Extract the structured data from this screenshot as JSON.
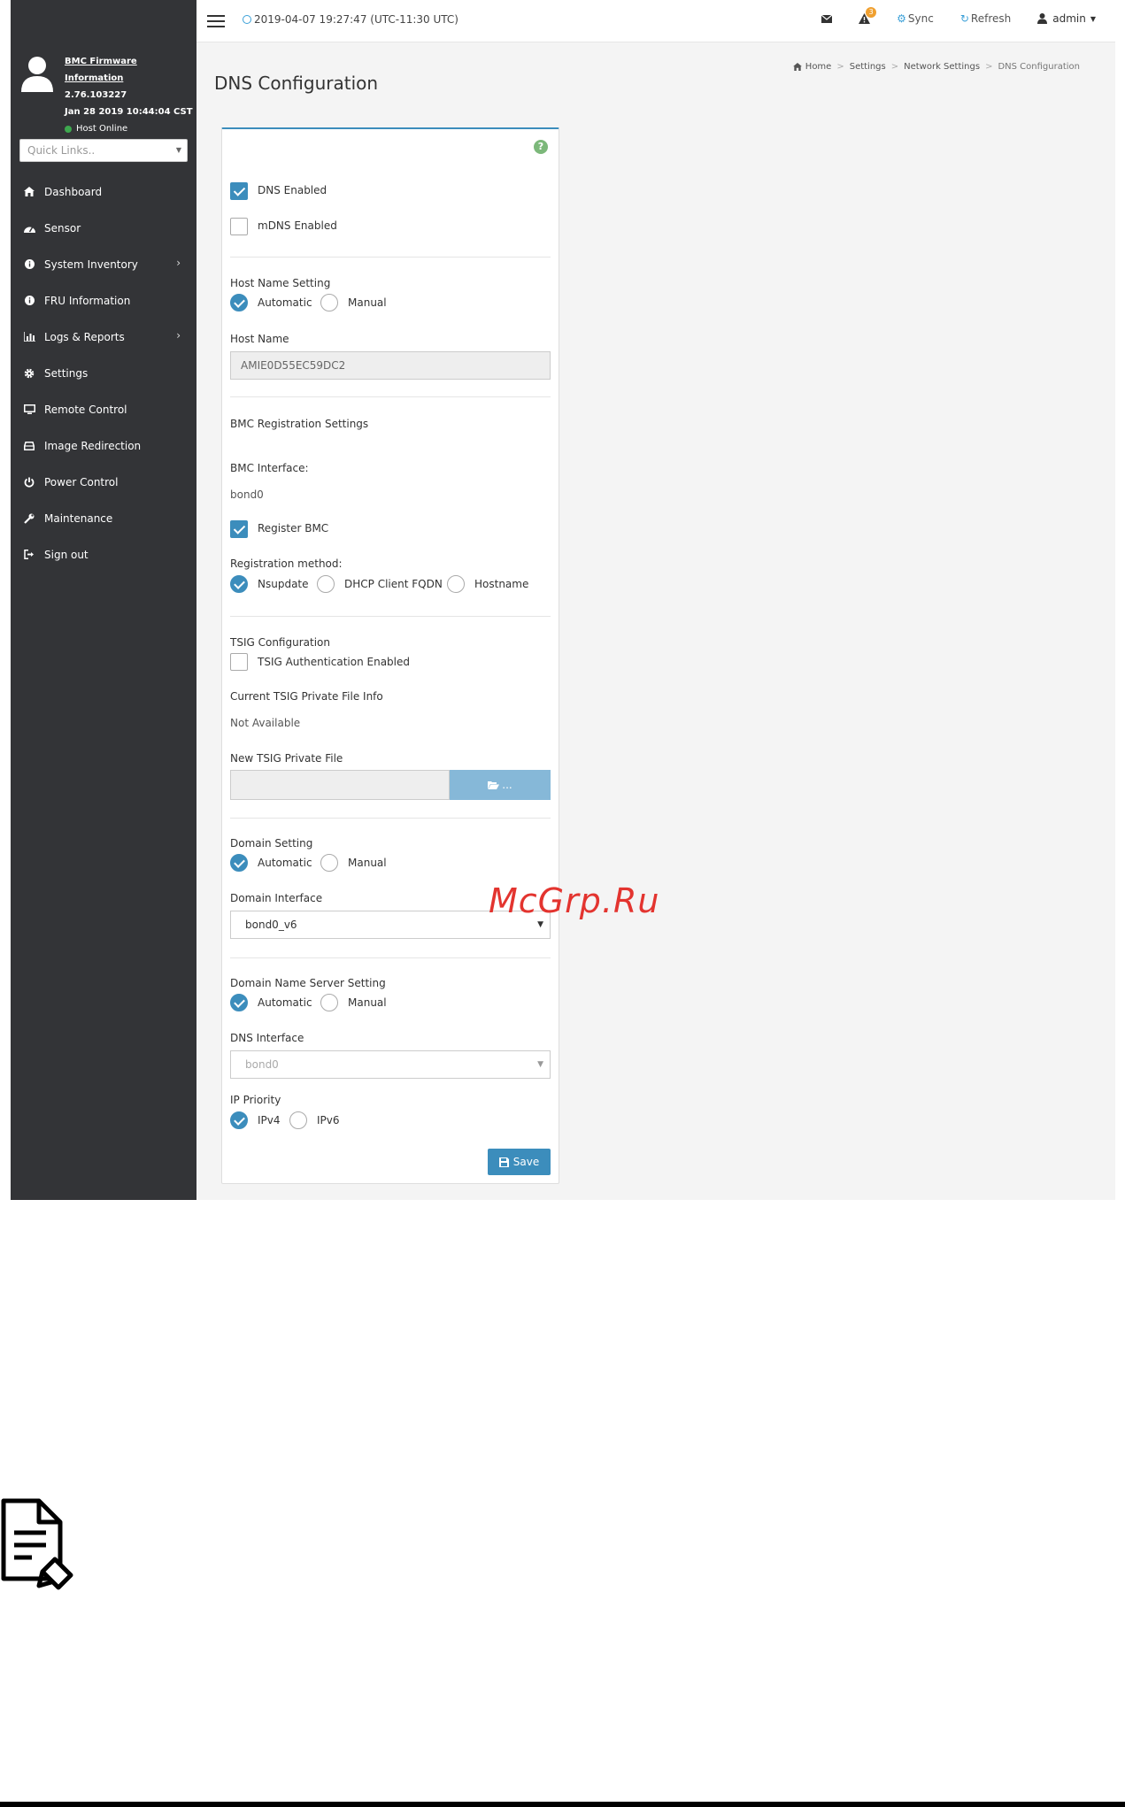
{
  "sidebar": {
    "firmware_link": "BMC Firmware Information",
    "firmware_version": "2.76.103227",
    "firmware_date": "Jan 28 2019 10:44:04 CST",
    "host_status": "Host Online",
    "quick_links_placeholder": "Quick Links..",
    "items": [
      {
        "label": "Dashboard"
      },
      {
        "label": "Sensor"
      },
      {
        "label": "System Inventory"
      },
      {
        "label": "FRU Information"
      },
      {
        "label": "Logs & Reports"
      },
      {
        "label": "Settings"
      },
      {
        "label": "Remote Control"
      },
      {
        "label": "Image Redirection"
      },
      {
        "label": "Power Control"
      },
      {
        "label": "Maintenance"
      },
      {
        "label": "Sign out"
      }
    ]
  },
  "topbar": {
    "datetime": "2019-04-07 19:27:47 (UTC-11:30 UTC)",
    "alert_count": "3",
    "sync_label": "Sync",
    "refresh_label": "Refresh",
    "user_label": "admin"
  },
  "page": {
    "title": "DNS Configuration",
    "breadcrumb": [
      "Home",
      "Settings",
      "Network Settings",
      "DNS Configuration"
    ]
  },
  "form": {
    "dns_enabled_label": "DNS Enabled",
    "mdns_enabled_label": "mDNS Enabled",
    "host_name_setting_label": "Host Name Setting",
    "automatic_label": "Automatic",
    "manual_label": "Manual",
    "host_name_label": "Host Name",
    "host_name_value": "AMIE0D55EC59DC2",
    "bmc_registration_settings_label": "BMC Registration Settings",
    "bmc_interface_label": "BMC Interface:",
    "bmc_interface_value": "bond0",
    "register_bmc_label": "Register BMC",
    "registration_method_label": "Registration method:",
    "nsupdate_label": "Nsupdate",
    "dhcp_client_fqdn_label": "DHCP Client FQDN",
    "hostname_label": "Hostname",
    "tsig_configuration_label": "TSIG Configuration",
    "tsig_auth_enabled_label": "TSIG Authentication Enabled",
    "current_tsig_label": "Current TSIG Private File Info",
    "current_tsig_value": "Not Available",
    "new_tsig_label": "New TSIG Private File",
    "file_button_label": "...",
    "domain_setting_label": "Domain Setting",
    "domain_interface_label": "Domain Interface",
    "domain_interface_value": "bond0_v6",
    "domain_name_server_setting_label": "Domain Name Server Setting",
    "dns_interface_label": "DNS Interface",
    "dns_interface_value": "bond0",
    "ip_priority_label": "IP Priority",
    "ipv4_label": "IPv4",
    "ipv6_label": "IPv6",
    "save_label": "Save"
  },
  "watermark": "McGrp.Ru",
  "colors": {
    "sidebar_bg": "#333437",
    "accent": "#3c8dbc",
    "status_online": "#3ea84f",
    "watermark": "#e3342f"
  }
}
